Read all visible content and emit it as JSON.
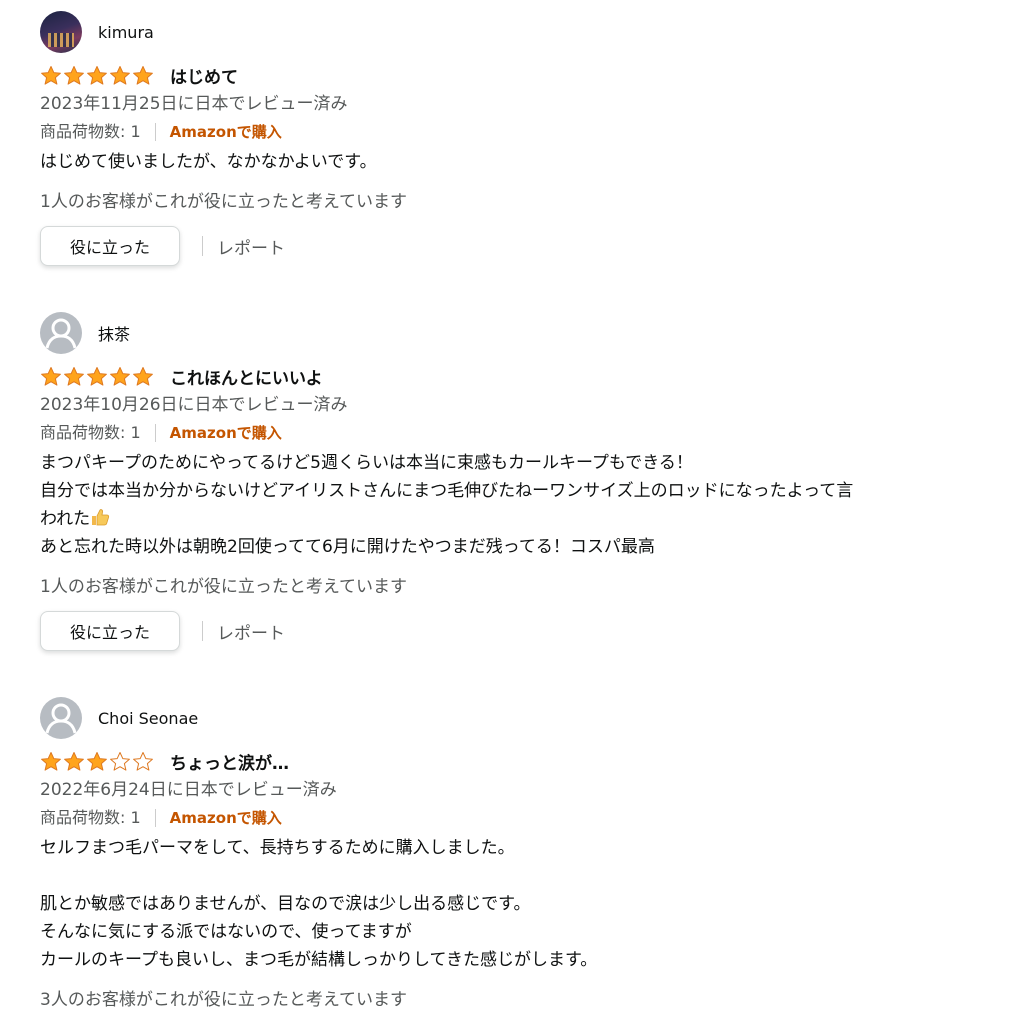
{
  "reviews": [
    {
      "name": "kimura",
      "avatar_type": "photo",
      "rating": 5,
      "title": "はじめて",
      "date": "2023年11月25日に日本でレビュー済み",
      "quantity": "商品荷物数: 1",
      "purchase": "Amazonで購入",
      "body": "はじめて使いましたが、なかなかよいです。",
      "helpful": "1人のお客様がこれが役に立ったと考えています",
      "helpful_button": "役に立った",
      "report": "レポート"
    },
    {
      "name": "抹茶",
      "avatar_type": "default",
      "rating": 5,
      "title": "これほんとにいいよ",
      "date": "2023年10月26日に日本でレビュー済み",
      "quantity": "商品荷物数: 1",
      "purchase": "Amazonで購入",
      "body_lines": [
        "まつパキープのためにやってるけど5週くらいは本当に束感もカールキープもできる！",
        "自分では本当か分からないけどアイリストさんにまつ毛伸びたねーワンサイズ上のロッドになったよって言",
        "われた",
        "あと忘れた時以外は朝晩2回使ってて6月に開けたやつまだ残ってる！コスパ最高"
      ],
      "helpful": "1人のお客様がこれが役に立ったと考えています",
      "helpful_button": "役に立った",
      "report": "レポート"
    },
    {
      "name": "Choi Seonae",
      "avatar_type": "default",
      "rating": 3,
      "title": "ちょっと涙が…",
      "date": "2022年6月24日に日本でレビュー済み",
      "quantity": "商品荷物数: 1",
      "purchase": "Amazonで購入",
      "body_lines": [
        "セルフまつ毛パーマをして、長持ちするために購入しました。",
        "",
        "肌とか敏感ではありませんが、目なので涙は少し出る感じです。",
        "そんなに気にする派ではないので、使ってますが",
        "カールのキープも良いし、まつ毛が結構しっかりしてきた感じがします。"
      ],
      "helpful": "3人のお客様がこれが役に立ったと考えています"
    }
  ],
  "colors": {
    "star": "#ffa41c",
    "star_stroke": "#de7921",
    "purchase": "#c45500",
    "secondary_text": "#565959"
  },
  "icons": {
    "star_filled": "star-filled-icon",
    "star_empty": "star-empty-icon",
    "thumbs_up": "thumbs-up-icon",
    "default_avatar": "person-icon"
  }
}
